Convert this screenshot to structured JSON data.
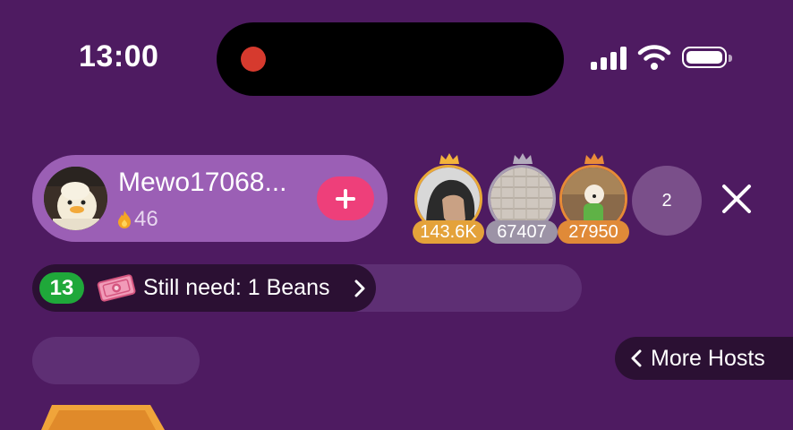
{
  "status_bar": {
    "time": "13:00",
    "icons": [
      "signal-icon",
      "wifi-icon",
      "battery-icon"
    ],
    "recording_color": "#d63a2e"
  },
  "host": {
    "name": "Mewo17068...",
    "stat": "46",
    "stat_icon": "flame-icon",
    "follow_icon": "plus-icon",
    "pill_color": "#9b5fb5",
    "follow_color": "#ee3f7a"
  },
  "viewers": [
    {
      "count": "143.6K",
      "crown": "gold",
      "badge_color": "#e4a23a"
    },
    {
      "count": "67407",
      "crown": "silver",
      "badge_color": "#9c93a6"
    },
    {
      "count": "27950",
      "crown": "bronze",
      "badge_color": "#e08a38"
    }
  ],
  "online_count": "2",
  "task": {
    "level": "13",
    "text": "Still need: 1 Beans",
    "level_color": "#1fa83a",
    "icon": "money-icon"
  },
  "more_hosts": {
    "label": "More Hosts"
  },
  "colors": {
    "background": "#4e1b61",
    "dark_pill": "#2b1033",
    "ghost_pill": "#5e2f74"
  }
}
